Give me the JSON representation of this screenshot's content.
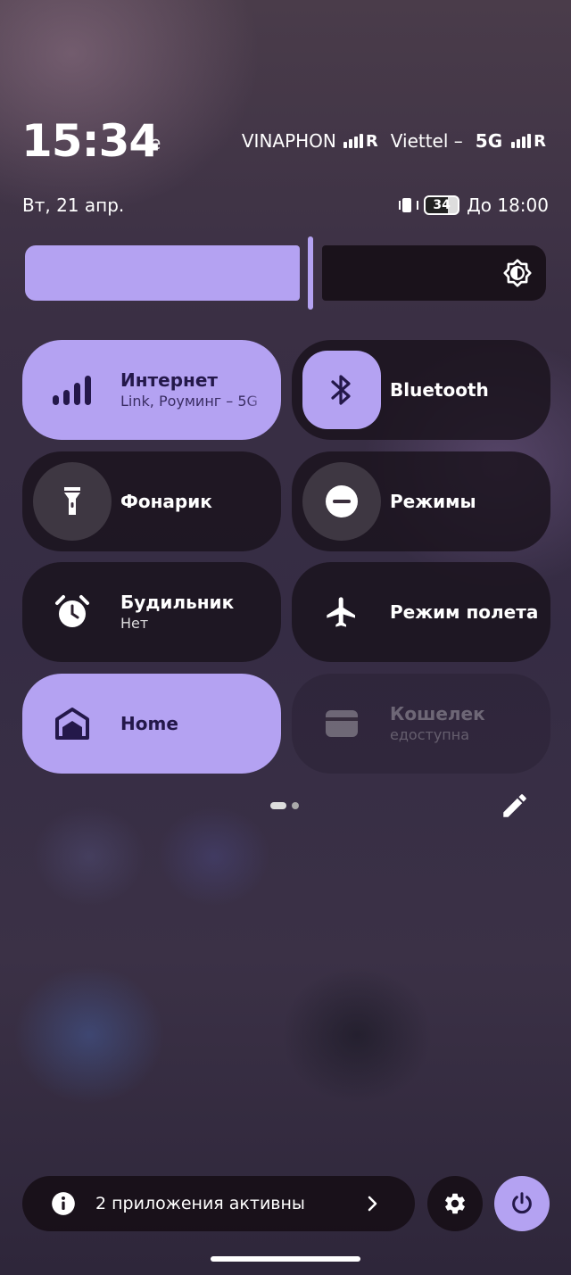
{
  "status": {
    "time": "15:34",
    "time_suffix": "е",
    "date": "Вт, 21 апр.",
    "carriers": [
      {
        "name": "VINAPHON",
        "network": "",
        "roaming": "R"
      },
      {
        "name": "Viettel –",
        "network": "5G",
        "roaming": "R"
      }
    ],
    "battery_level": "34",
    "alarm_until": "До 18:00"
  },
  "brightness": {
    "level": 0.55,
    "icon": "brightness-auto-icon"
  },
  "tiles": [
    {
      "title": "Интернет",
      "subtitle": "Link, Роуминг – 5G",
      "state": "on",
      "icon": "signal-bars-icon"
    },
    {
      "title": "Bluetooth",
      "subtitle": "",
      "state": "off",
      "icon": "bluetooth-icon"
    },
    {
      "title": "Фонарик",
      "subtitle": "",
      "state": "off",
      "icon": "flashlight-icon"
    },
    {
      "title": "Режимы",
      "subtitle": "",
      "state": "off",
      "icon": "do-not-disturb-icon"
    },
    {
      "title": "Будильник",
      "subtitle": "Нет",
      "state": "off",
      "icon": "alarm-clock-icon"
    },
    {
      "title": "Режим полета",
      "subtitle": "",
      "state": "off",
      "icon": "airplane-icon"
    },
    {
      "title": "Home",
      "subtitle": "",
      "state": "on",
      "icon": "home-icon"
    },
    {
      "title": "Кошелек",
      "subtitle": "едоступна",
      "state": "disabled",
      "icon": "wallet-icon"
    }
  ],
  "pager": {
    "pages": 2,
    "current": 1
  },
  "footer": {
    "active_apps": "2 приложения активны"
  },
  "colors": {
    "accent": "#b4a2f2",
    "accent_text": "#24184a",
    "tile_off": "#1a121c"
  }
}
